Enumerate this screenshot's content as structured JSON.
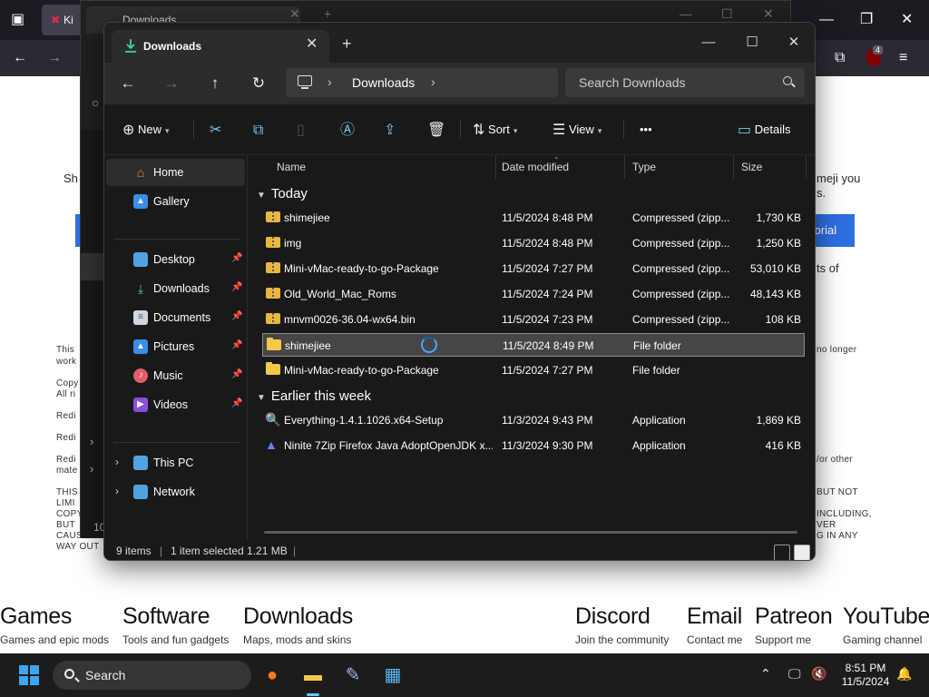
{
  "background_browser": {
    "tab_icon": "x-logo-icon",
    "tab_label": "Ki",
    "notification_count": "4",
    "page_text": {
      "left_heading": "Sh",
      "right_heading_1": "meji you",
      "right_heading_2": "s.",
      "right_button": "torial",
      "right_text": "ts of",
      "left_this": "This",
      "left_work": "work",
      "left_copy": "Copy",
      "left_all": "All ri",
      "left_redi1": "Redi",
      "left_redi2": "Redi",
      "left_redi3": "Redi",
      "left_mate": "mate",
      "left_this_caps": "THIS",
      "left_limi": "LIMI",
      "left_copy_caps": "COPY",
      "left_but": "BUT",
      "left_cause": "CAUSE",
      "left_way": "WAY OUT",
      "right_no_longer": "no longer",
      "right_or_other": "/or other",
      "right_but_not": "BUT NOT",
      "right_including": "INCLUDING,",
      "right_ver": "VER",
      "right_in_any": "G IN ANY"
    },
    "footer_nav": [
      {
        "title": "Games",
        "subtitle": "Games and epic mods"
      },
      {
        "title": "Software",
        "subtitle": "Tools and fun gadgets"
      },
      {
        "title": "Downloads",
        "subtitle": "Maps, mods and skins"
      },
      {
        "title": "Discord",
        "subtitle": "Join the community"
      },
      {
        "title": "Email",
        "subtitle": "Contact me"
      },
      {
        "title": "Patreon",
        "subtitle": "Support me"
      },
      {
        "title": "YouTube",
        "subtitle": "Gaming channel"
      }
    ]
  },
  "back_window": {
    "tab_title": "Downloads",
    "left_number": "10"
  },
  "explorer": {
    "tab_title": "Downloads",
    "address": {
      "breadcrumb": "Downloads"
    },
    "search_placeholder": "Search Downloads",
    "toolbar": {
      "new_label": "New",
      "sort_label": "Sort",
      "view_label": "View",
      "more_label": "•••",
      "details_label": "Details"
    },
    "nav": {
      "home": "Home",
      "gallery": "Gallery",
      "desktop": "Desktop",
      "downloads": "Downloads",
      "documents": "Documents",
      "pictures": "Pictures",
      "music": "Music",
      "videos": "Videos",
      "this_pc": "This PC",
      "network": "Network"
    },
    "columns": {
      "name": "Name",
      "date": "Date modified",
      "type": "Type",
      "size": "Size"
    },
    "groups": {
      "today": "Today",
      "earlier": "Earlier this week"
    },
    "files_today": [
      {
        "name": "shimejiee",
        "date": "11/5/2024 8:48 PM",
        "type": "Compressed (zipp...",
        "size": "1,730 KB",
        "icon": "zip-folder-icon"
      },
      {
        "name": "img",
        "date": "11/5/2024 8:48 PM",
        "type": "Compressed (zipp...",
        "size": "1,250 KB",
        "icon": "zip-folder-icon"
      },
      {
        "name": "Mini-vMac-ready-to-go-Package",
        "date": "11/5/2024 7:27 PM",
        "type": "Compressed (zipp...",
        "size": "53,010 KB",
        "icon": "zip-folder-icon"
      },
      {
        "name": "Old_World_Mac_Roms",
        "date": "11/5/2024 7:24 PM",
        "type": "Compressed (zipp...",
        "size": "48,143 KB",
        "icon": "zip-folder-icon"
      },
      {
        "name": "mnvm0026-36.04-wx64.bin",
        "date": "11/5/2024 7:23 PM",
        "type": "Compressed (zipp...",
        "size": "108 KB",
        "icon": "zip-folder-icon"
      },
      {
        "name": "shimejiee",
        "date": "11/5/2024 8:49 PM",
        "type": "File folder",
        "size": "",
        "icon": "folder-icon",
        "selected": true
      },
      {
        "name": "Mini-vMac-ready-to-go-Package",
        "date": "11/5/2024 7:27 PM",
        "type": "File folder",
        "size": "",
        "icon": "folder-icon"
      }
    ],
    "files_earlier": [
      {
        "name": "Everything-1.4.1.1026.x64-Setup",
        "date": "11/3/2024 9:43 PM",
        "type": "Application",
        "size": "1,869 KB",
        "icon": "magnifier-app-icon"
      },
      {
        "name": "Ninite 7Zip Firefox Java AdoptOpenJDK x...",
        "date": "11/3/2024 9:30 PM",
        "type": "Application",
        "size": "416 KB",
        "icon": "ninite-app-icon"
      }
    ],
    "status": {
      "item_count": "9 items",
      "selection": "1 item selected  1.21 MB"
    }
  },
  "taskbar": {
    "search_label": "Search",
    "time": "8:51 PM",
    "date": "11/5/2024"
  }
}
